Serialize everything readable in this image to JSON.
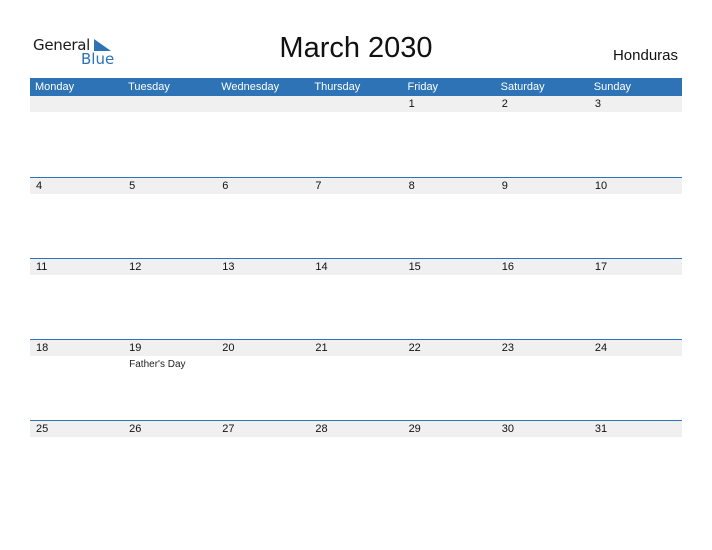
{
  "logo": {
    "text_general": "General",
    "text_blue": "Blue",
    "icon": "triangle-flag-icon",
    "brand_color": "#2e73b6"
  },
  "title": "March 2030",
  "country": "Honduras",
  "colors": {
    "header_bg": "#2e73b6",
    "date_band": "#f0f0f0"
  },
  "weekdays": [
    "Monday",
    "Tuesday",
    "Wednesday",
    "Thursday",
    "Friday",
    "Saturday",
    "Sunday"
  ],
  "weeks": [
    {
      "days": [
        {
          "date": ""
        },
        {
          "date": ""
        },
        {
          "date": ""
        },
        {
          "date": ""
        },
        {
          "date": "1"
        },
        {
          "date": "2"
        },
        {
          "date": "3"
        }
      ]
    },
    {
      "days": [
        {
          "date": "4"
        },
        {
          "date": "5"
        },
        {
          "date": "6"
        },
        {
          "date": "7"
        },
        {
          "date": "8"
        },
        {
          "date": "9"
        },
        {
          "date": "10"
        }
      ]
    },
    {
      "days": [
        {
          "date": "11"
        },
        {
          "date": "12"
        },
        {
          "date": "13"
        },
        {
          "date": "14"
        },
        {
          "date": "15"
        },
        {
          "date": "16"
        },
        {
          "date": "17"
        }
      ]
    },
    {
      "days": [
        {
          "date": "18"
        },
        {
          "date": "19",
          "event": "Father's Day"
        },
        {
          "date": "20"
        },
        {
          "date": "21"
        },
        {
          "date": "22"
        },
        {
          "date": "23"
        },
        {
          "date": "24"
        }
      ]
    },
    {
      "days": [
        {
          "date": "25"
        },
        {
          "date": "26"
        },
        {
          "date": "27"
        },
        {
          "date": "28"
        },
        {
          "date": "29"
        },
        {
          "date": "30"
        },
        {
          "date": "31"
        }
      ]
    }
  ]
}
